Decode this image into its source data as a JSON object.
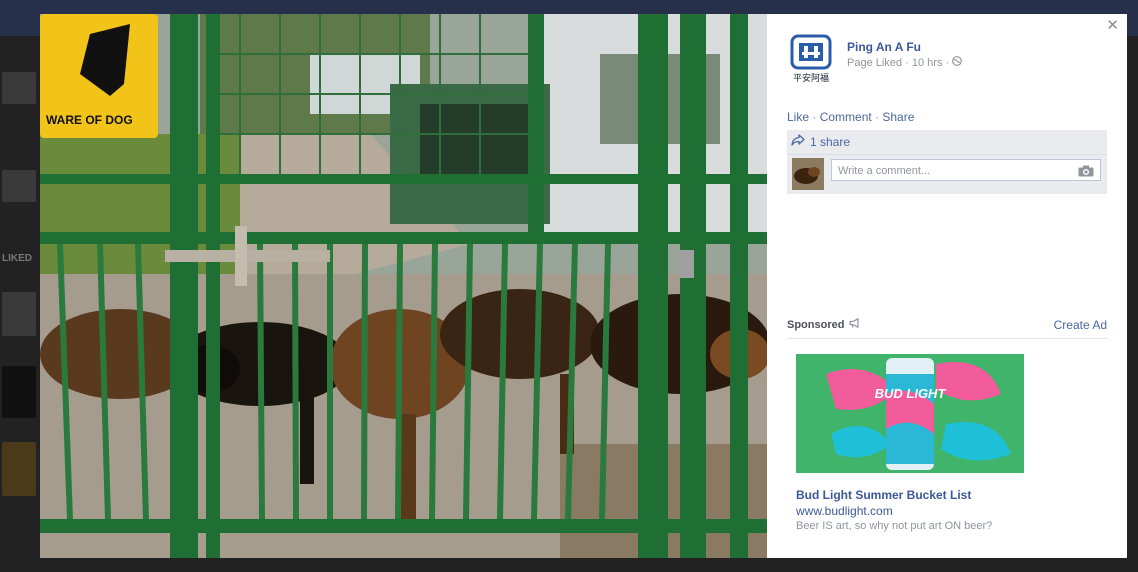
{
  "background": {
    "section_label": "LIKED"
  },
  "photo": {
    "sign_text": "WARE OF DOG",
    "alt": "German shepherd dogs behind a green gate"
  },
  "post": {
    "page_name": "Ping An A Fu",
    "avatar_caption": "平安阿福",
    "status": "Page Liked",
    "time": "10 hrs",
    "sep": " · ",
    "audience_icon": "globe-icon"
  },
  "actions": {
    "like": "Like",
    "comment": "Comment",
    "share": "Share",
    "sep": " · "
  },
  "ufi": {
    "share_count": "1 share",
    "comment_placeholder": "Write a comment..."
  },
  "sponsored": {
    "label": "Sponsored",
    "create_ad": "Create Ad",
    "ad": {
      "title": "Bud Light Summer Bucket List",
      "url": "www.budlight.com",
      "description": "Beer IS art, so why not put art ON beer?",
      "can_text": "BUD LIGHT"
    }
  },
  "colors": {
    "link": "#4b67a1",
    "page_name": "#3b5998",
    "muted": "#90949c",
    "ad_background": "#3fb46a",
    "gate_green": "#1f6e34"
  }
}
